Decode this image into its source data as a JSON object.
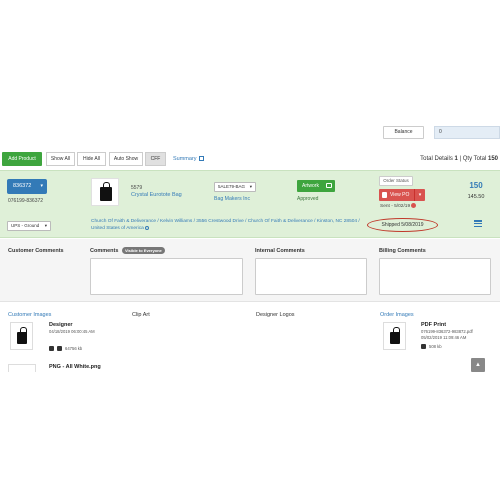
{
  "balance": {
    "label": "Balance",
    "value": "0"
  },
  "toolbar": {
    "add_product": "Add Product",
    "show_all": "Show All",
    "hide_all": "Hide All",
    "auto_show": "Auto Show",
    "cff": "CFF",
    "summary": "Summary",
    "totals_prefix": "Total Details",
    "total_count": "1",
    "qty_prefix": "| Qty Total",
    "qty_total": "150"
  },
  "order": {
    "order_number": "836372",
    "sub_number": "076199-836372",
    "product_code": "5579",
    "product_name": "Crystal Eurotote Bag",
    "sku_select": "5ALE79-BAG",
    "vendor": "Bag Makers Inc",
    "artwork_label": "Artwork",
    "approved": "Approved",
    "order_status": "Order Status",
    "view_po": "View PO",
    "sent": "Sent - 5/02/19",
    "qty": "150",
    "price": "145.50",
    "ship_method": "UPS - Ground",
    "address": "Church Of Faith & Deliverance / Kelvin Williams / 3556 Crestwood Drive / Church Of Faith & Deliverance / Kinston, NC 28504 / United States of America",
    "shipped": "Shipped 5/08/2019"
  },
  "comments": {
    "customer_comments": "Customer Comments",
    "comments": "Comments",
    "visible_badge": "Visible to Everyone",
    "internal_comments": "Internal Comments",
    "billing_comments": "Billing Comments"
  },
  "images": {
    "customer_images": "Customer Images",
    "clip_art": "Clip Art",
    "designer_logos": "Designer Logos",
    "order_images": "Order Images",
    "designer_name": "Designer",
    "designer_date": "04/18/2019 06:00:45 AM",
    "designer_size": "64756 kb",
    "pdf_name": "PDF Print",
    "pdf_file": "076199-836372-983872.pdf",
    "pdf_date": "05/02/2019 11:09:46 AM",
    "pdf_size": "508 kb",
    "png_name": "PNG - All White.png"
  }
}
